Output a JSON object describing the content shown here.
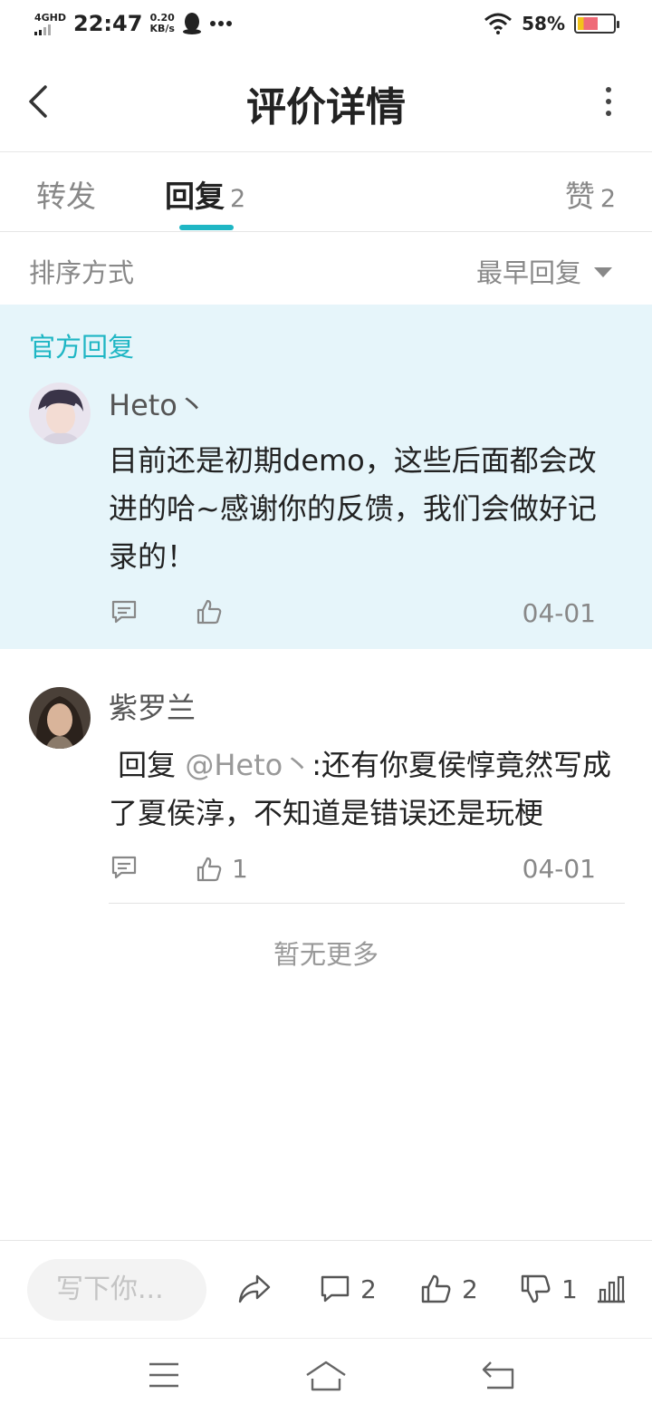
{
  "status_bar": {
    "network": "4GHD",
    "time": "22:47",
    "speed_value": "0.20",
    "speed_unit": "KB/s",
    "battery": "58%",
    "battery_level": 0.58,
    "icons": [
      "signal-icon",
      "qq-icon",
      "more-dots-icon",
      "wifi-icon",
      "battery-icon"
    ]
  },
  "header": {
    "title": "评价详情"
  },
  "tabs": [
    {
      "label": "转发",
      "count": ""
    },
    {
      "label": "回复",
      "count": "2",
      "active": true
    },
    {
      "label": "赞",
      "count": "2"
    }
  ],
  "sort": {
    "label": "排序方式",
    "value": "最早回复"
  },
  "official": {
    "label": "官方回复",
    "username": "Heto丶",
    "content": "目前还是初期demo，这些后面都会改进的哈~感谢你的反馈，我们会做好记录的！",
    "likes": "",
    "date": "04-01"
  },
  "reply": {
    "username": "紫罗兰",
    "prefix": "回复",
    "mention": "@Heto丶",
    "content": ":还有你夏侯惇竟然写成了夏侯淳，不知道是错误还是玩梗",
    "likes": "1",
    "date": "04-01"
  },
  "no_more": "暂无更多",
  "bottom_bar": {
    "input_placeholder": "写下你...",
    "comments": "2",
    "likes": "2",
    "dislikes": "1"
  },
  "colors": {
    "accent": "#1fb6c4",
    "official_bg": "#e6f5fa"
  }
}
